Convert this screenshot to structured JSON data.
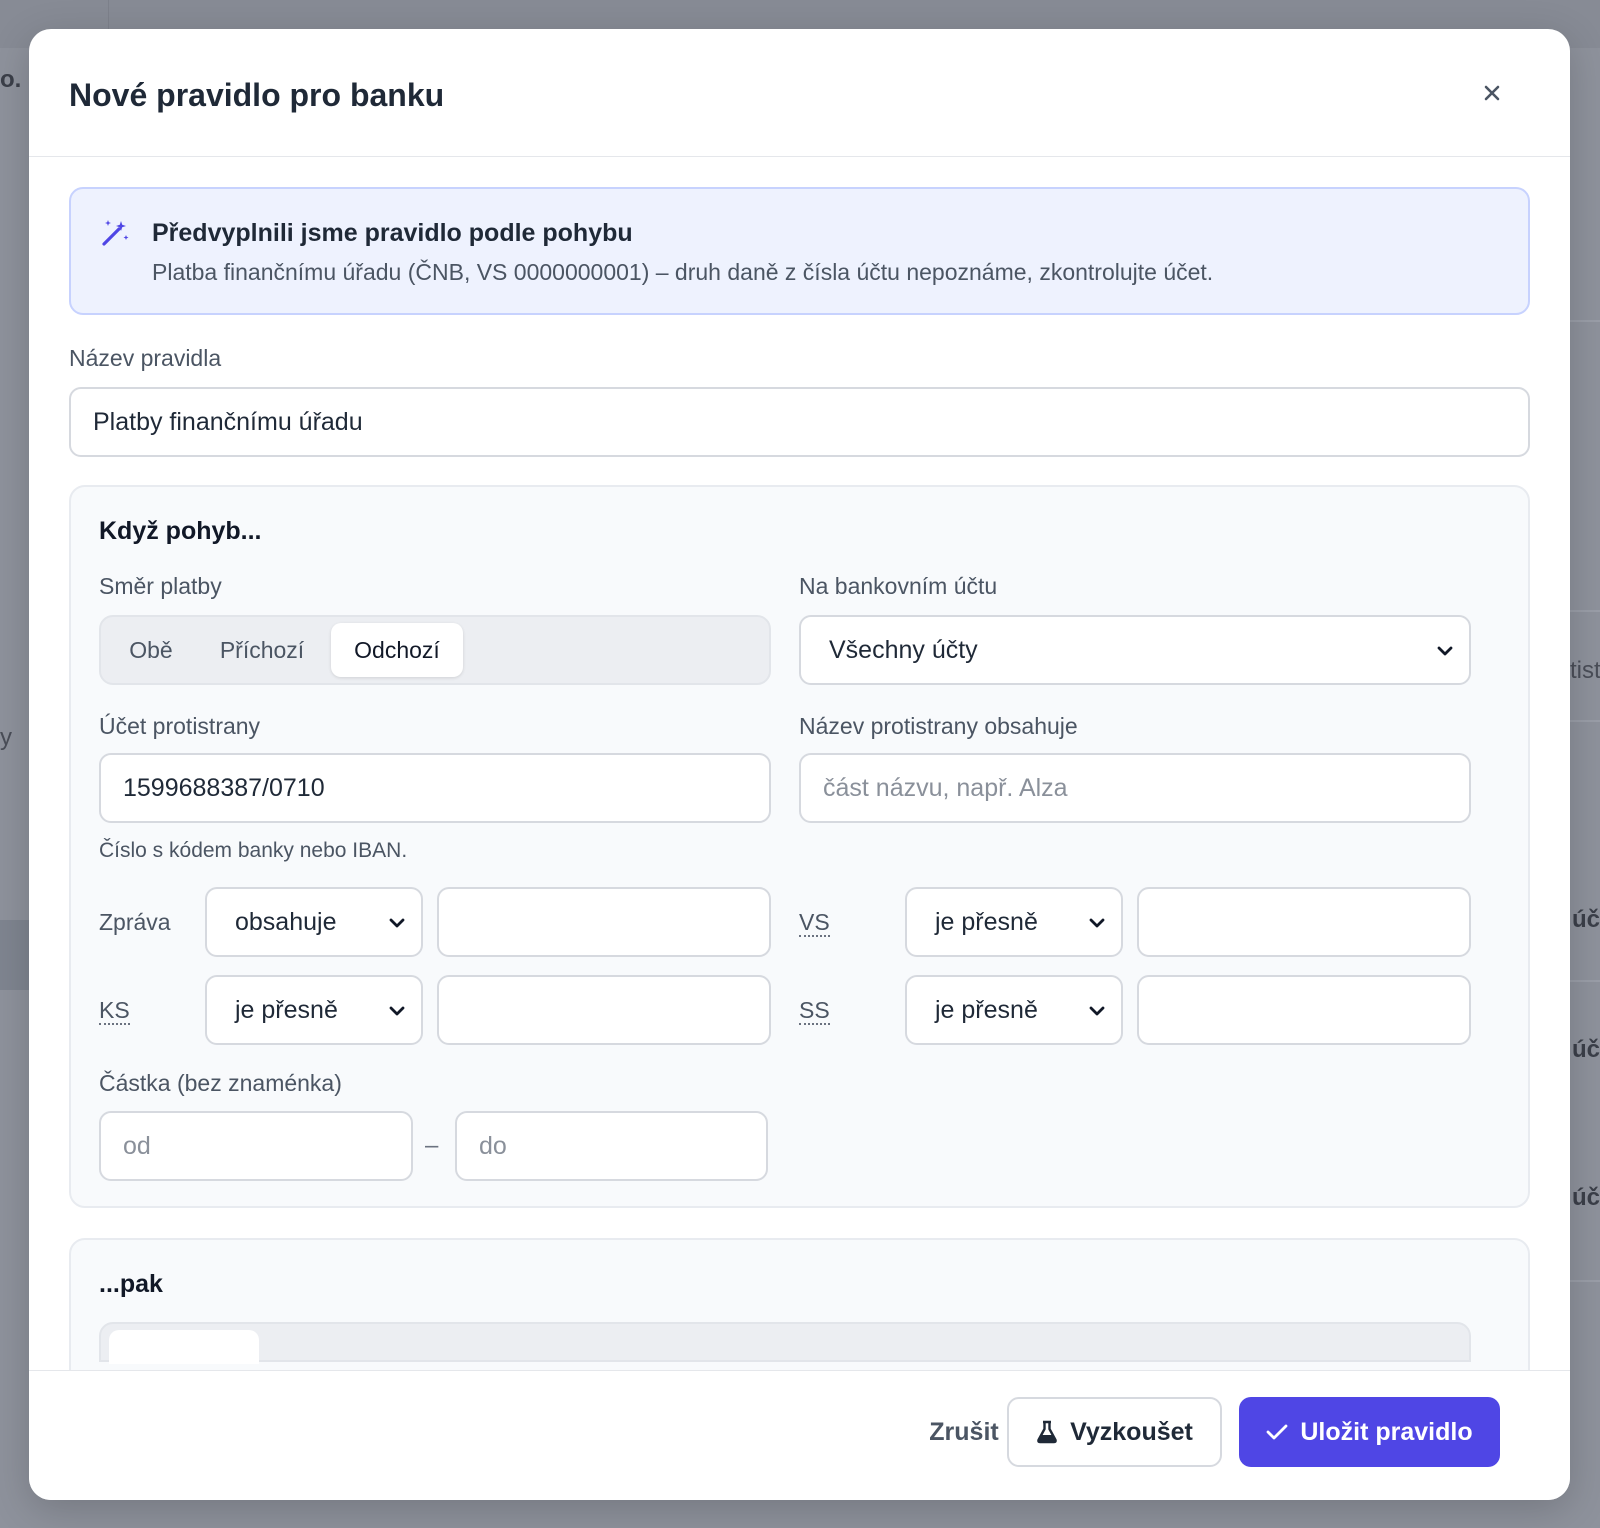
{
  "background": {
    "frag_top_left": "o.",
    "frag_left_mid": "y",
    "frag_right_1": "tist",
    "frag_right_2": "úč",
    "frag_right_3": "úč",
    "frag_right_4": "úč"
  },
  "modal": {
    "title": "Nové pravidlo pro banku",
    "close_icon": "close-icon"
  },
  "info": {
    "icon": "magic-wand-icon",
    "title": "Předvyplnili jsme pravidlo podle pohybu",
    "text": "Platba finančnímu úřadu (ČNB, VS 0000000001) – druh daně z čísla účtu nepoznáme, zkontrolujte účet."
  },
  "rule_name": {
    "label": "Název pravidla",
    "value": "Platby finančnímu úřadu"
  },
  "conditions": {
    "title": "Když pohyb...",
    "direction": {
      "label": "Směr platby",
      "options": [
        "Obě",
        "Příchozí",
        "Odchozí"
      ],
      "selected": "Odchozí"
    },
    "bank_account": {
      "label": "Na bankovním účtu",
      "value": "Všechny účty"
    },
    "counterparty_account": {
      "label": "Účet protistrany",
      "value": "1599688387/0710",
      "hint": "Číslo s kódem banky nebo IBAN."
    },
    "counterparty_name": {
      "label": "Název protistrany obsahuje",
      "placeholder": "část názvu, např. Alza",
      "value": ""
    },
    "message": {
      "label": "Zpráva",
      "operator": "obsahuje",
      "value": ""
    },
    "vs": {
      "label": "VS",
      "operator": "je přesně",
      "value": ""
    },
    "ks": {
      "label": "KS",
      "operator": "je přesně",
      "value": ""
    },
    "ss": {
      "label": "SS",
      "operator": "je přesně",
      "value": ""
    },
    "amount": {
      "label": "Částka (bez znaménka)",
      "from_placeholder": "od",
      "to_placeholder": "do",
      "separator": "–"
    }
  },
  "actions": {
    "title": "...pak"
  },
  "footer": {
    "cancel_label": "Zrušit",
    "test_label": "Vyzkoušet",
    "test_icon": "flask-icon",
    "save_label": "Uložit pravidlo",
    "save_icon": "check-icon"
  },
  "colors": {
    "accent": "#4f46e5",
    "info_bg": "#eef2fe",
    "info_border": "#c7d2fe",
    "panel_bg": "#f8fafc"
  }
}
